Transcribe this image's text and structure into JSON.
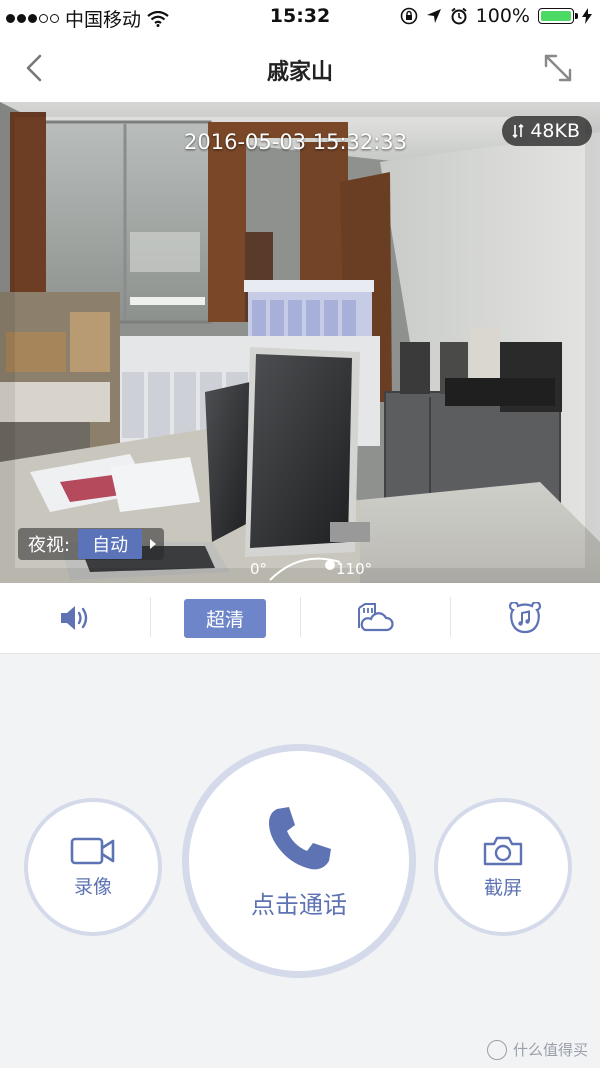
{
  "status_bar": {
    "carrier": "中国移动",
    "time": "15:32",
    "battery": "100%",
    "icons": [
      "signal-dots-icon",
      "wifi-icon",
      "orientation-lock-icon",
      "location-icon",
      "alarm-icon",
      "battery-icon",
      "charging-icon"
    ]
  },
  "nav": {
    "title": "戚家山",
    "back_icon": "chevron-left-icon",
    "expand_icon": "expand-icon"
  },
  "video": {
    "timestamp": "2016-05-03 15:32:33",
    "bitrate": "48KB",
    "night_vision_label": "夜视:",
    "night_vision_value": "自动",
    "angle_start": "0°",
    "angle_end": "110°"
  },
  "toolbar": {
    "volume_icon": "speaker-icon",
    "quality_label": "超清",
    "cloud_icon": "cloud-storage-icon",
    "music_icon": "music-icon"
  },
  "controls": {
    "record_label": "录像",
    "call_label": "点击通话",
    "screenshot_label": "截屏"
  },
  "watermark": "什么值得买",
  "colors": {
    "accent": "#5e73b4",
    "accent_fill": "#6e86c9",
    "ring": "#d4daea",
    "background": "#f2f3f5"
  }
}
